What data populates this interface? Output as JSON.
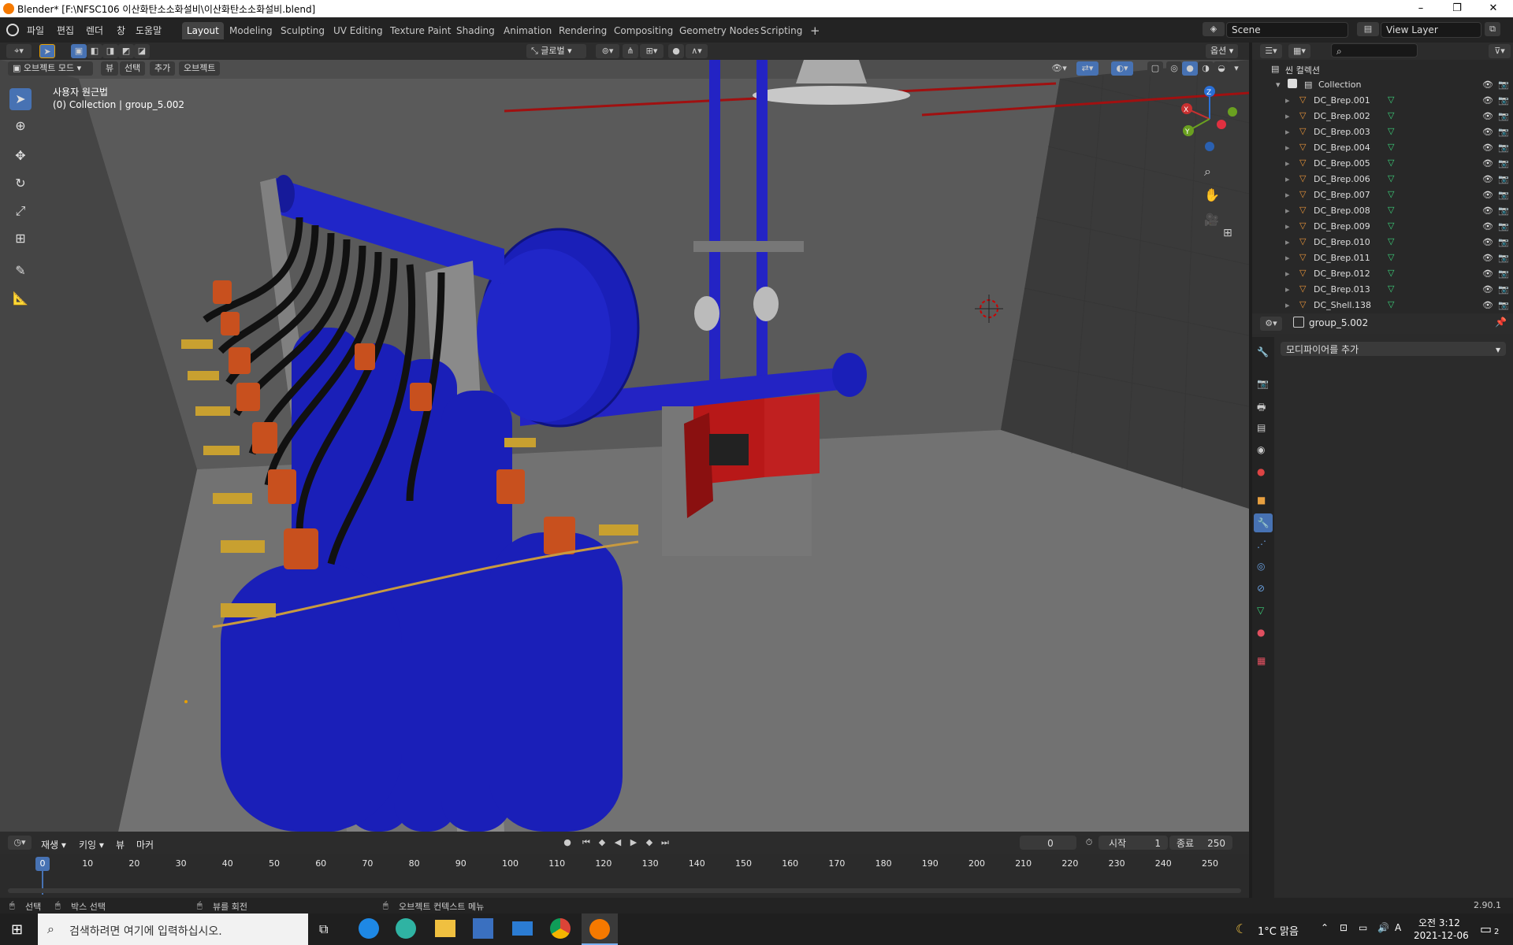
{
  "window": {
    "title": "Blender* [F:\\NFSC106 이산화탄소소화설비\\이산화탄소소화설비.blend]",
    "minimize": "–",
    "maximize": "❐",
    "close": "✕"
  },
  "menus": [
    "파일",
    "편집",
    "렌더",
    "창",
    "도움말"
  ],
  "workspaces": [
    "Layout",
    "Modeling",
    "Sculpting",
    "UV Editing",
    "Texture Paint",
    "Shading",
    "Animation",
    "Rendering",
    "Compositing",
    "Geometry Nodes",
    "Scripting",
    "+"
  ],
  "scene": {
    "label": "Scene",
    "view_layer": "View Layer"
  },
  "viewport": {
    "mode": "오브젝트 모드",
    "header_menus": [
      "뷰",
      "선택",
      "추가",
      "오브젝트"
    ],
    "transform": "글로벌",
    "options": "옵션",
    "view_name": "사용자 원근법",
    "collection_info": "(0) Collection | group_5.002",
    "gizmo": {
      "x": "X",
      "y": "Y",
      "z": "Z"
    }
  },
  "outliner": {
    "root": "씬 컬렉션",
    "collection": "Collection",
    "items": [
      "DC_Brep.001",
      "DC_Brep.002",
      "DC_Brep.003",
      "DC_Brep.004",
      "DC_Brep.005",
      "DC_Brep.006",
      "DC_Brep.007",
      "DC_Brep.008",
      "DC_Brep.009",
      "DC_Brep.010",
      "DC_Brep.011",
      "DC_Brep.012",
      "DC_Brep.013",
      "DC_Shell.138"
    ]
  },
  "properties": {
    "object_name": "group_5.002",
    "add_modifier": "모디파이어를 추가"
  },
  "timeline": {
    "menus": [
      "재생",
      "키잉",
      "뷰",
      "마커"
    ],
    "current_frame": "0",
    "start_label": "시작",
    "start": "1",
    "end_label": "종료",
    "end": "250",
    "ticks": [
      "0",
      "10",
      "20",
      "30",
      "40",
      "50",
      "60",
      "70",
      "80",
      "90",
      "100",
      "110",
      "120",
      "130",
      "140",
      "150",
      "160",
      "170",
      "180",
      "190",
      "200",
      "210",
      "220",
      "230",
      "240",
      "250"
    ],
    "playhead": "0"
  },
  "status": {
    "select": "선택",
    "box_select": "박스 선택",
    "rotate_view": "뷰를 회전",
    "context_menu": "오브젝트 컨텍스트 메뉴",
    "version": "2.90.1"
  },
  "taskbar": {
    "search_placeholder": "검색하려면 여기에 입력하십시오.",
    "weather": "1°C 맑음",
    "time": "오전 3:12",
    "date": "2021-12-06",
    "notif_count": "2",
    "ime": "A"
  },
  "colors": {
    "accent": "#4772b3",
    "cylinder": "#1a1fb8",
    "valve": "#c8501e",
    "panel_red": "#b81818",
    "bg": "#4b4b4b"
  }
}
